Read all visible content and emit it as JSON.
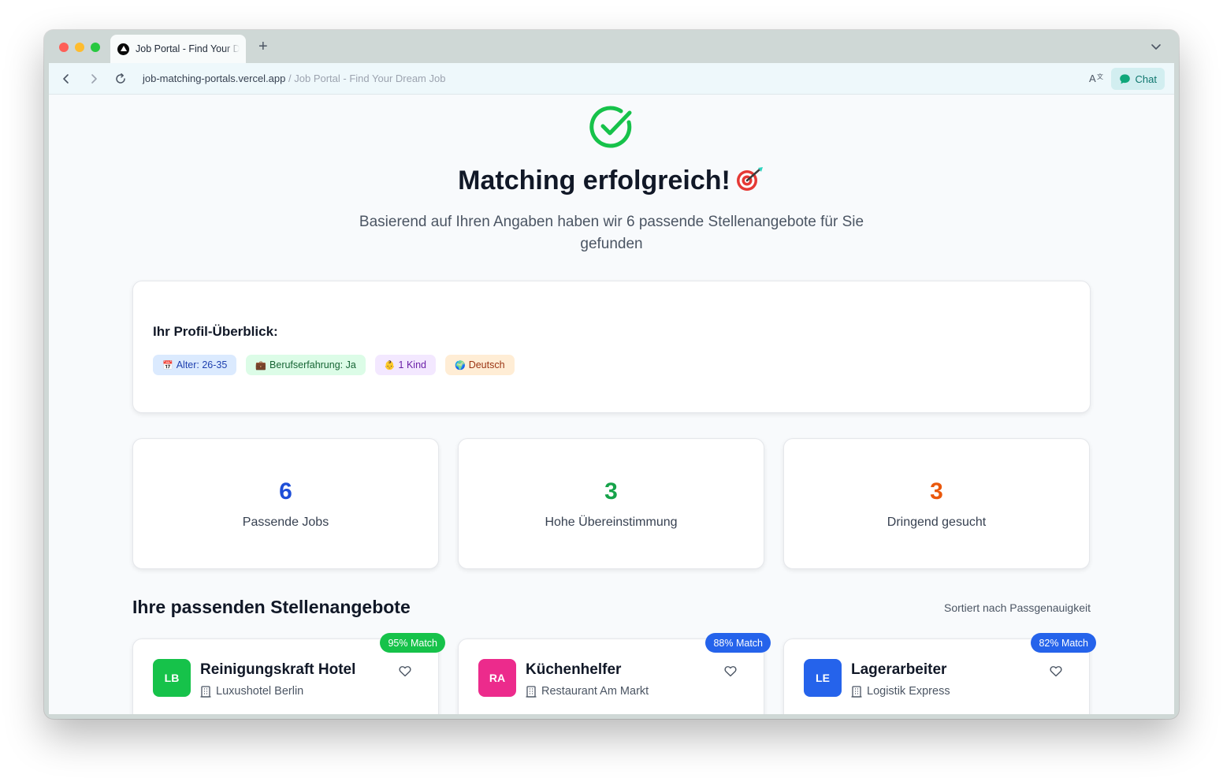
{
  "browser": {
    "tab_title": "Job Portal - Find Your Dream Job",
    "url_host": "job-matching-portals.vercel.app",
    "url_separator": "/",
    "url_page_title": "Job Portal - Find Your Dream Job",
    "chat_label": "Chat"
  },
  "hero": {
    "title": "Matching erfolgreich!",
    "subtitle": "Basierend auf Ihren Angaben haben wir 6 passende Stellenangebote für Sie gefunden"
  },
  "profile": {
    "title": "Ihr Profil-Überblick:",
    "chips": [
      {
        "icon": "📅",
        "label": "Alter: 26-35"
      },
      {
        "icon": "💼",
        "label": "Berufserfahrung: Ja"
      },
      {
        "icon": "👶",
        "label": "1 Kind"
      },
      {
        "icon": "🌍",
        "label": "Deutsch"
      }
    ]
  },
  "stats": [
    {
      "value": "6",
      "label": "Passende Jobs",
      "color": "#1d4ed8"
    },
    {
      "value": "3",
      "label": "Hohe Übereinstimmung",
      "color": "#16a34a"
    },
    {
      "value": "3",
      "label": "Dringend gesucht",
      "color": "#ea580c"
    }
  ],
  "jobs_section": {
    "title": "Ihre passenden Stellenangebote",
    "sort_label": "Sortiert nach Passgenauigkeit"
  },
  "jobs": [
    {
      "initials": "LB",
      "title": "Reinigungskraft Hotel",
      "company": "Luxushotel Berlin",
      "match": "95% Match",
      "logo_color": "#16c24a",
      "badge_color": "#16c24a"
    },
    {
      "initials": "RA",
      "title": "Küchenhelfer",
      "company": "Restaurant Am Markt",
      "match": "88% Match",
      "logo_color": "#ec2b8c",
      "badge_color": "#2563eb"
    },
    {
      "initials": "LE",
      "title": "Lagerarbeiter",
      "company": "Logistik Express",
      "match": "82% Match",
      "logo_color": "#2563eb",
      "badge_color": "#2563eb"
    }
  ],
  "icons": {
    "success": "check-circle-icon",
    "hero_emoji": "target-icon",
    "company": "building-icon",
    "favorite": "heart-icon"
  }
}
